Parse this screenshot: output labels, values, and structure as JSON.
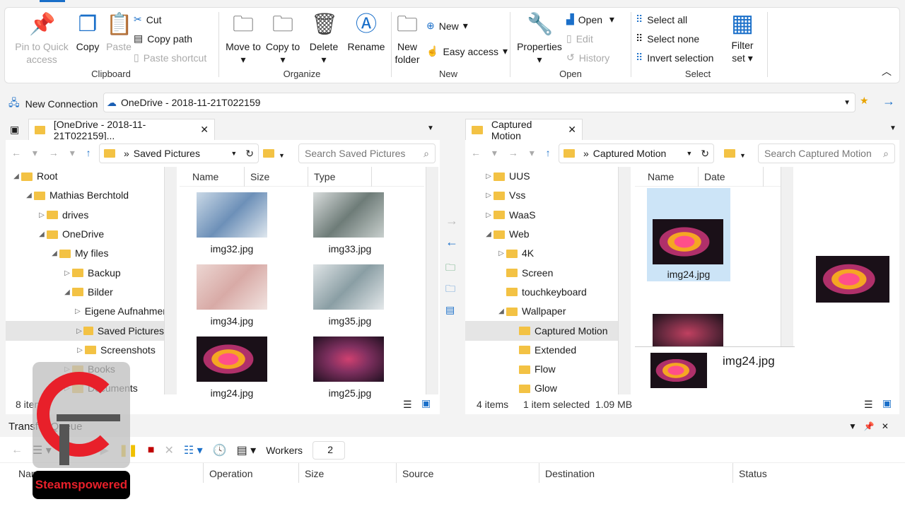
{
  "ribbon": {
    "clipboard": {
      "pin": "Pin to Quick access",
      "copy": "Copy",
      "paste": "Paste",
      "cut": "Cut",
      "copy_path": "Copy path",
      "paste_shortcut": "Paste shortcut",
      "label": "Clipboard"
    },
    "organize": {
      "move_to": "Move to",
      "copy_to": "Copy to",
      "delete": "Delete",
      "rename": "Rename",
      "label": "Organize"
    },
    "new": {
      "new_folder": "New folder",
      "new": "New",
      "easy_access": "Easy access",
      "label": "New"
    },
    "open": {
      "properties": "Properties",
      "open": "Open",
      "edit": "Edit",
      "history": "History",
      "label": "Open"
    },
    "select": {
      "select_all": "Select all",
      "select_none": "Select none",
      "invert": "Invert selection",
      "filter_set": "Filter set",
      "label": "Select"
    }
  },
  "connection": {
    "new_connection": "New Connection",
    "current": "OneDrive - 2018-11-21T022159"
  },
  "left": {
    "tab": "[OneDrive - 2018-11-21T022159]...",
    "path": "Saved Pictures",
    "search_placeholder": "Search Saved Pictures",
    "tree": [
      "Root",
      "Mathias Berchtold",
      "drives",
      "OneDrive",
      "My files",
      "Backup",
      "Bilder",
      "Eigene Aufnahmen",
      "Saved Pictures",
      "Screenshots",
      "Books",
      "Documents"
    ],
    "columns": [
      "Name",
      "Size",
      "Type"
    ],
    "files": [
      "img32.jpg",
      "img33.jpg",
      "img34.jpg",
      "img35.jpg",
      "img24.jpg",
      "img25.jpg"
    ],
    "status": "8 items"
  },
  "right": {
    "tab": "Captured Motion",
    "path": "Captured Motion",
    "search_placeholder": "Search Captured Motion",
    "tree": [
      "UUS",
      "Vss",
      "WaaS",
      "Web",
      "4K",
      "Screen",
      "touchkeyboard",
      "Wallpaper",
      "Captured Motion",
      "Extended",
      "Flow",
      "Glow"
    ],
    "columns": [
      "Name",
      "Date"
    ],
    "files": [
      "img24.jpg"
    ],
    "preview_name": "img24.jpg",
    "status_items": "4 items",
    "status_selected": "1 item selected  1.09 MB"
  },
  "queue": {
    "title": "Transfer Queue",
    "workers_label": "Workers",
    "workers": "2",
    "columns": [
      "Name",
      "Operation",
      "Size",
      "Source",
      "Destination",
      "Status"
    ]
  },
  "watermark": {
    "text": "Steamspowered"
  }
}
